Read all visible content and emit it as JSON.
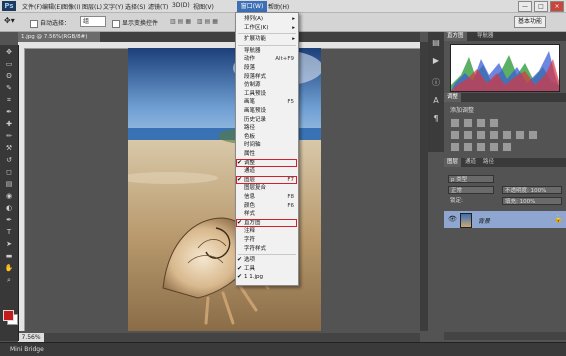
{
  "menubar": {
    "logo": "Ps",
    "items": [
      "文件(F)",
      "编辑(E)",
      "图像(I)",
      "图层(L)",
      "文字(Y)",
      "选择(S)",
      "滤镜(T)",
      "3D(D)",
      "视图(V)",
      "窗口(W)",
      "帮助(H)"
    ],
    "window_controls": [
      "—",
      "□",
      "×"
    ]
  },
  "options": {
    "auto_select_label": "自动选择：",
    "auto_select_value": "组",
    "show_transform_label": "显示变换控件",
    "workspace": "基本功能"
  },
  "document": {
    "tab_label": "1.jpg @ 7.56%(RGB/8#)",
    "zoom": "7.56%"
  },
  "bottom": {
    "mini_bridge": "Mini Bridge"
  },
  "panels": {
    "top_tabs": [
      "直方图",
      "导航器"
    ],
    "adjust_tab": "调整",
    "adjust_title": "添加调整",
    "layer_tabs": [
      "图层",
      "通道",
      "路径"
    ],
    "blend_mode": "正常",
    "opacity": "不透明度: 100%",
    "lock_label": "锁定:",
    "fill": "填充: 100%",
    "search": "p 类型",
    "layer_name": "背景"
  },
  "window_menu": {
    "title": "窗口(W)",
    "items": [
      {
        "label": "排列(A)",
        "shortcut": "",
        "checked": false,
        "submenu": true
      },
      {
        "label": "工作区(K)",
        "shortcut": "",
        "checked": false,
        "submenu": true
      },
      {
        "label": "扩展功能",
        "shortcut": "",
        "checked": false,
        "submenu": true
      },
      {
        "label": "导航器",
        "shortcut": "",
        "checked": false
      },
      {
        "label": "动作",
        "shortcut": "Alt+F9",
        "checked": false
      },
      {
        "label": "段落",
        "shortcut": "",
        "checked": false
      },
      {
        "label": "段落样式",
        "shortcut": "",
        "checked": false
      },
      {
        "label": "仿制源",
        "shortcut": "",
        "checked": false
      },
      {
        "label": "工具预设",
        "shortcut": "",
        "checked": false
      },
      {
        "label": "画笔",
        "shortcut": "F5",
        "checked": false
      },
      {
        "label": "画笔预设",
        "shortcut": "",
        "checked": false
      },
      {
        "label": "历史记录",
        "shortcut": "",
        "checked": false
      },
      {
        "label": "路径",
        "shortcut": "",
        "checked": false
      },
      {
        "label": "色板",
        "shortcut": "",
        "checked": false
      },
      {
        "label": "时间轴",
        "shortcut": "",
        "checked": false
      },
      {
        "label": "属性",
        "shortcut": "",
        "checked": false
      },
      {
        "label": "调整",
        "shortcut": "",
        "checked": true,
        "highlight": true
      },
      {
        "label": "通道",
        "shortcut": "",
        "checked": false
      },
      {
        "label": "图层",
        "shortcut": "F7",
        "checked": true,
        "highlight": true
      },
      {
        "label": "图层复合",
        "shortcut": "",
        "checked": false
      },
      {
        "label": "信息",
        "shortcut": "F8",
        "checked": false
      },
      {
        "label": "颜色",
        "shortcut": "F6",
        "checked": false
      },
      {
        "label": "样式",
        "shortcut": "",
        "checked": false
      },
      {
        "label": "直方图",
        "shortcut": "",
        "checked": true,
        "highlight": true
      },
      {
        "label": "注释",
        "shortcut": "",
        "checked": false
      },
      {
        "label": "字符",
        "shortcut": "",
        "checked": false
      },
      {
        "label": "字符样式",
        "shortcut": "",
        "checked": false
      },
      {
        "label": "选项",
        "shortcut": "",
        "checked": true
      },
      {
        "label": "工具",
        "shortcut": "",
        "checked": true
      },
      {
        "label": "1 1.jpg",
        "shortcut": "",
        "checked": true
      }
    ]
  },
  "icons": {
    "tools": [
      "move-icon",
      "marquee-icon",
      "lasso-icon",
      "quick-select-icon",
      "crop-icon",
      "eyedropper-icon",
      "healing-icon",
      "brush-icon",
      "stamp-icon",
      "history-brush-icon",
      "eraser-icon",
      "gradient-icon",
      "blur-icon",
      "dodge-icon",
      "pen-icon",
      "type-icon",
      "path-select-icon",
      "shape-icon",
      "hand-icon",
      "zoom-icon"
    ],
    "tool_glyphs": [
      "✥",
      "▭",
      "ʘ",
      "✎",
      "⌗",
      "✒",
      "✚",
      "✏",
      "⚒",
      "↺",
      "◻",
      "▤",
      "◉",
      "◐",
      "✒",
      "T",
      "➤",
      "▬",
      "✋",
      "⌕"
    ]
  },
  "colors": {
    "foreground": "#c41b1b",
    "background": "#ffffff",
    "highlight_border": "#d0222a",
    "menu_active": "#3c6fb5"
  }
}
